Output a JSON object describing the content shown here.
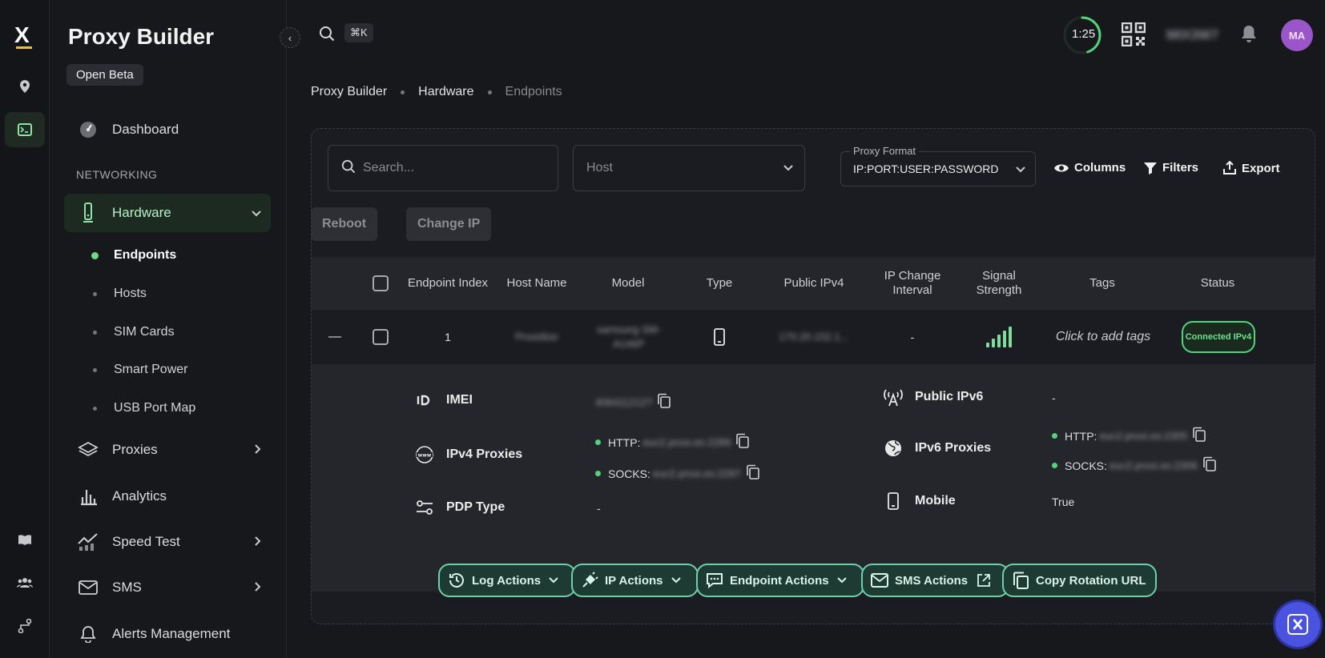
{
  "app": {
    "brand": "Proxy Builder",
    "logo_text": "X",
    "beta_badge": "Open Beta"
  },
  "sidebar": {
    "dashboard": "Dashboard",
    "section_label": "NETWORKING",
    "hardware": "Hardware",
    "sub_items": [
      "Endpoints",
      "Hosts",
      "SIM Cards",
      "Smart Power",
      "USB Port Map"
    ],
    "proxies": "Proxies",
    "analytics": "Analytics",
    "speed_test": "Speed Test",
    "sms": "SMS",
    "alerts": "Alerts Management"
  },
  "topbar": {
    "shortcut": "⌘K",
    "timer": "1:25",
    "timer_progress": 0.45,
    "user_code": "MIX3W7",
    "avatar_initials": "MA"
  },
  "breadcrumb": [
    "Proxy Builder",
    "Hardware",
    "Endpoints"
  ],
  "toolbar": {
    "search_placeholder": "Search...",
    "host_placeholder": "Host",
    "proxy_format_label": "Proxy Format",
    "proxy_format_value": "IP:PORT:USER:PASSWORD",
    "columns": "Columns",
    "filters": "Filters",
    "export": "Export",
    "reboot": "Reboot",
    "change_ip": "Change IP"
  },
  "table": {
    "headers": {
      "endpoint_index": "Endpoint Index",
      "host_name": "Host Name",
      "model": "Model",
      "type": "Type",
      "public_ipv4": "Public IPv4",
      "ip_change_interval": "IP Change Interval",
      "signal_strength": "Signal Strength",
      "tags": "Tags",
      "status": "Status"
    },
    "row": {
      "collapse": "—",
      "index": "1",
      "host_name": "Proxidize",
      "model": "samsung SM-A146P",
      "public_ipv4": "170.20.152.1...",
      "ip_change_interval": "-",
      "signal_bars": 5,
      "tags_hint": "Click to add tags",
      "status": "Connected IPv4"
    }
  },
  "detail": {
    "imei_label": "IMEI",
    "imei_value": "406411212?",
    "ipv4_label": "IPv4 Proxies",
    "ipv4_http_prefix": "HTTP:",
    "ipv4_http": "euc2.proxi.es:2289",
    "ipv4_socks_prefix": "SOCKS:",
    "ipv4_socks": "euc2.proxi.es:2297",
    "pdp_label": "PDP Type",
    "pdp_value": "-",
    "public_ipv6_label": "Public IPv6",
    "public_ipv6_value": "-",
    "ipv6_label": "IPv6 Proxies",
    "ipv6_http_prefix": "HTTP:",
    "ipv6_http": "euc2.proxi.es:2305",
    "ipv6_socks_prefix": "SOCKS:",
    "ipv6_socks": "euc2.proxi.es:2306",
    "mobile_label": "Mobile",
    "mobile_value": "True"
  },
  "actions": {
    "log": "Log Actions",
    "ip": "IP Actions",
    "endpoint": "Endpoint Actions",
    "sms": "SMS Actions",
    "rotation": "Copy Rotation URL"
  },
  "colors": {
    "accent_green": "#4fd57a",
    "action_border": "#6fcfa8",
    "avatar": "#9a56c9",
    "fab": "#4a53e0"
  }
}
